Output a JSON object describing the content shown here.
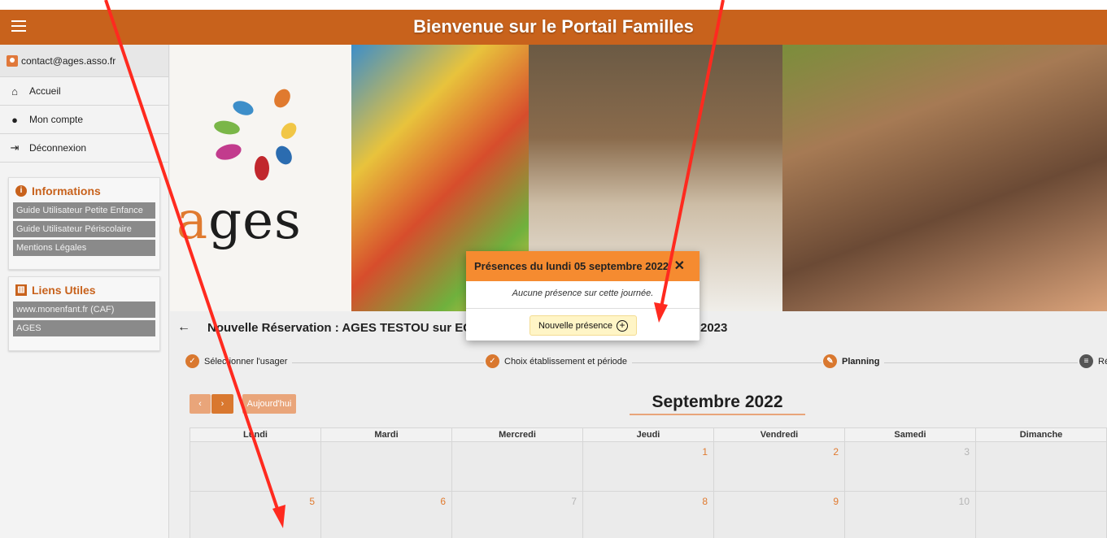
{
  "header": {
    "title": "Bienvenue sur le Portail Familles"
  },
  "sidebar": {
    "user_email": "contact@ages.asso.fr",
    "nav": [
      {
        "label": "Accueil",
        "icon": "home-icon"
      },
      {
        "label": "Mon compte",
        "icon": "account-icon"
      },
      {
        "label": "Déconnexion",
        "icon": "logout-icon"
      }
    ],
    "informations": {
      "title": "Informations",
      "links": [
        "Guide Utilisateur Petite Enfance",
        "Guide Utilisateur Périscolaire",
        "Mentions Légales"
      ]
    },
    "liens": {
      "title": "Liens Utiles",
      "links": [
        "www.monenfant.fr (CAF)",
        "AGES"
      ]
    }
  },
  "banner": {
    "logo_text_a": "a",
    "logo_text_rest": "ges"
  },
  "reservation": {
    "title": "Nouvelle Réservation : AGES TESTOU sur EC",
    "title_suffix": "2023",
    "back_icon": "back-arrow-icon"
  },
  "steps": [
    {
      "label": "Sélectionner l'usager",
      "icon": "check-icon"
    },
    {
      "label": "Choix établissement et période",
      "icon": "check-icon"
    },
    {
      "label": "Planning",
      "icon": "pencil-icon"
    },
    {
      "label": "Ré",
      "icon": "list-icon"
    }
  ],
  "calendar": {
    "month_title": "Septembre 2022",
    "prev_label": "‹",
    "next_label": "›",
    "today_label": "Aujourd'hui",
    "weekdays": [
      "Lundi",
      "Mardi",
      "Mercredi",
      "Jeudi",
      "Vendredi",
      "Samedi",
      "Dimanche"
    ],
    "rows": [
      [
        "",
        "",
        "",
        "1",
        "2",
        "3",
        ""
      ],
      [
        "5",
        "6",
        "7",
        "8",
        "9",
        "10",
        ""
      ]
    ]
  },
  "popup": {
    "title": "Présences du lundi 05 septembre 2022",
    "close_icon": "close-icon",
    "message": "Aucune présence sur cette journée.",
    "new_button": "Nouvelle présence",
    "plus_icon": "plus-circle-icon"
  },
  "colors": {
    "brand": "#c8621c",
    "popup_header": "#f58b30",
    "annotation_arrow": "#ff2a1f"
  }
}
